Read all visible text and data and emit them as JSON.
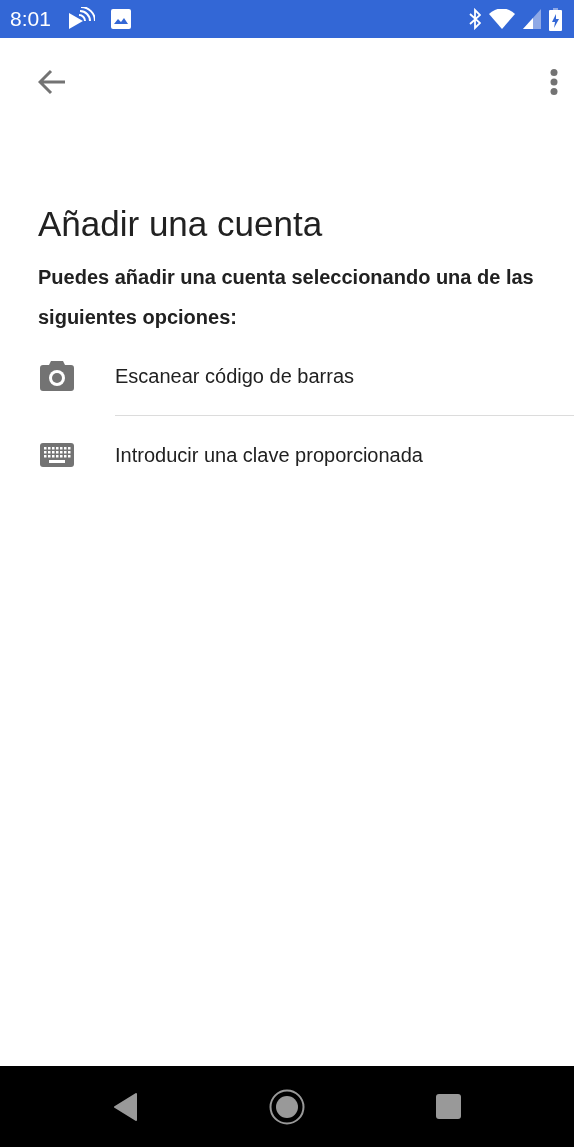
{
  "status_bar": {
    "time": "8:01"
  },
  "title": "Añadir una cuenta",
  "description": "Puedes añadir una cuenta seleccionando una de las siguientes opciones:",
  "options": [
    {
      "kind": "camera",
      "label": "Escanear código de barras"
    },
    {
      "kind": "keyboard",
      "label": "Introducir una clave proporcionada"
    }
  ]
}
